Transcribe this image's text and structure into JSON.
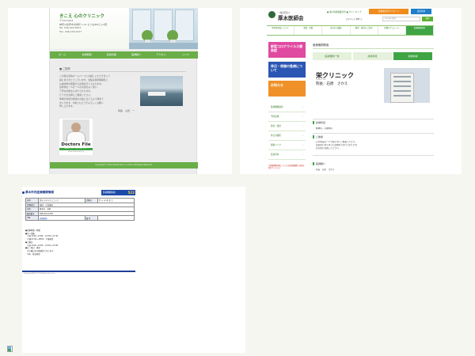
{
  "clinic_site": {
    "logo": "きこえ 心のクリニック",
    "header_lines": [
      "〒243-0012",
      "神奈川県厚木市幸町 1-11 むつみMSビル2階",
      "Tel. 046-224-5653",
      "Fax. 046-224-4217"
    ],
    "nav": [
      "ホーム",
      "診療時間",
      "診療内容",
      "医師紹介",
      "アクセス",
      "リンク"
    ],
    "section_title": "■ ご挨拶",
    "body_lines": [
      "この度は当院ホームページにお越しいただきまして",
      "誠にありがとうございます。当院は耳鼻咽喉科と",
      "心療内科の両面から診療を行っております。",
      "患者様お一人お一人のお話をよく伺い、",
      "丁寧な診療を心がけております。",
      "どうぞお気軽にご相談ください。",
      "地域の皆様の健康のお役に立てるよう努めて",
      "まいります。今後ともどうぞよろしくお願い",
      "申し上げます。"
    ],
    "signature": "院長　山田　一",
    "doctors_file": {
      "title": "Doctors File",
      "subtitle": "全国のドクター 8万人のドクター",
      "url": "https://doctorsfile.jp"
    },
    "footer": "Copyright © 2012 Kikoekokoro no Clinic All Rights Reserved."
  },
  "association_site": {
    "small_title": "一般社団法人",
    "name": "厚木医師会",
    "name_en": "ATSUGI MEDICAL ASSOCIATION",
    "top_links": "● 個人情報保護方針 ● サイトマップ",
    "btn_orange": "各種書式ダウンロード",
    "btn_blue": "会員専用",
    "font_size_label": "文字サイズ 標準 大",
    "search_placeholder": "Google 検索",
    "search_button": "検索",
    "nav": [
      {
        "label": "厚木医師会について",
        "active": false
      },
      {
        "label": "事業・活動",
        "active": false
      },
      {
        "label": "休日の当番医",
        "active": false
      },
      {
        "label": "健診・検診のご案内",
        "active": false
      },
      {
        "label": "各種スケジュール",
        "active": false
      },
      {
        "label": "医療機関検索",
        "active": true
      }
    ],
    "banners": [
      "新型コロナウイルス感染症",
      "休日・夜間の急病について",
      "お知らせ"
    ],
    "side_menu": [
      "医療機関検索",
      "予防接種",
      "健診・検診",
      "休日当番医",
      "関連リンク",
      "会員専用"
    ],
    "side_note": "※医療機関情報については各医療機関に直接お問合せください",
    "page_title": "医療機関検索",
    "tabs": [
      {
        "label": "医療機関一覧",
        "active": false
      },
      {
        "label": "診療科目",
        "active": false
      },
      {
        "label": "診療情報",
        "active": true
      }
    ],
    "clinic_name": "栄クリニック",
    "clinic_en": "Sakae Clinic",
    "director": "院長：石原　さかえ",
    "sections": [
      {
        "title": "診療科目",
        "lines": [
          "精神科、心療内科"
        ]
      },
      {
        "title": "ご挨拶",
        "lines": [
          "心の悩みは一人で抱えずにご相談ください。",
          "患者様に寄り添った診療を心がけております。",
          "お気軽にお越しください。"
        ]
      },
      {
        "title": "医師紹介",
        "lines": [
          "院長　石原　さかえ"
        ]
      }
    ]
  },
  "info_table": {
    "title": "厚木市内医療機関情報",
    "badge": "医療機関情報",
    "badge_num": "522",
    "rows": [
      [
        "名称",
        "栄デンタルクリニック",
        "診療日",
        "月 火 水 木 金 土"
      ],
      [
        "診療科目",
        "歯科・小児歯科",
        "",
        ""
      ],
      [
        "住所",
        "厚木市　栄町",
        "",
        ""
      ],
      [
        "電話番号",
        "046-221-1234",
        "",
        ""
      ],
      [
        "URL",
        "詳細情報",
        "備 考",
        ""
      ]
    ],
    "hours": [
      "●診療時間・時間",
      "●月～金曜",
      "　午前 9:00～13:00　14:30～17:30",
      "　午後14:30～18:00　午後休診",
      "●土曜日",
      "　午前 9:00～13:00　14:30～17:00",
      "●日・祝日　休診",
      "　※土曜日は午後休診となります",
      "　※木・祝は休診"
    ],
    "footer": "Copyright ATSUGI CITY. All Rights Reserved."
  }
}
